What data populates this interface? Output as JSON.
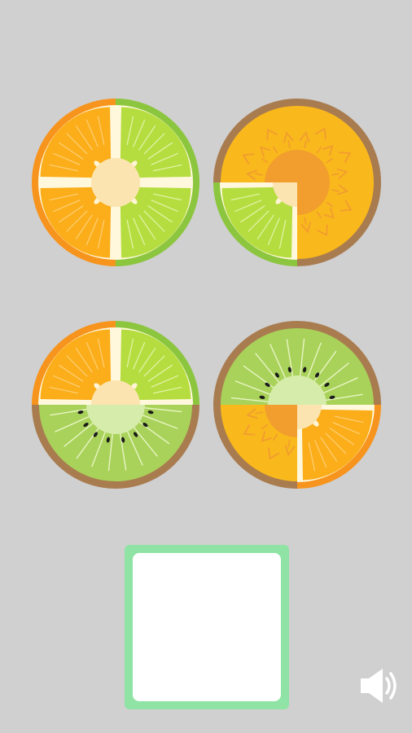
{
  "game": {
    "tiles": [
      {
        "id": "tile-1",
        "quadrants": [
          "orange",
          "lime",
          "lime",
          "orange"
        ]
      },
      {
        "id": "tile-2",
        "quadrants": [
          "melon",
          "melon",
          "melon",
          "lime"
        ]
      },
      {
        "id": "tile-3",
        "quadrants": [
          "orange",
          "lime",
          "kiwi",
          "kiwi"
        ]
      },
      {
        "id": "tile-4",
        "quadrants": [
          "kiwi",
          "kiwi",
          "orange",
          "melon"
        ]
      }
    ],
    "answer_slot": {
      "state": "empty"
    },
    "sound": {
      "icon": "speaker-icon",
      "state": "on"
    }
  },
  "colors": {
    "background": "#d0d0d0",
    "slot_border": "#8fe3a4",
    "slot_fill": "#ffffff",
    "orange_rind": "#f7941d",
    "orange_flesh": "#fbad1a",
    "lime_rind": "#8cc63f",
    "lime_flesh": "#b5dd3f",
    "kiwi_rind": "#a97c50",
    "kiwi_flesh": "#a9d25a",
    "melon_rind": "#a97c50",
    "melon_flesh": "#f9b91c"
  }
}
